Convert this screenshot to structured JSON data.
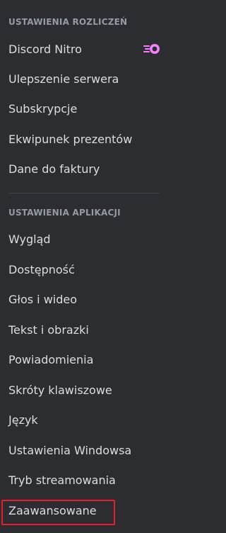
{
  "billing": {
    "header": "USTAWIENIA ROZLICZEŃ",
    "items": [
      {
        "label": "Discord Nitro",
        "icon": "nitro-icon"
      },
      {
        "label": "Ulepszenie serwera"
      },
      {
        "label": "Subskrypcje"
      },
      {
        "label": "Ekwipunek prezentów"
      },
      {
        "label": "Dane do faktury"
      }
    ]
  },
  "app": {
    "header": "USTAWIENIA APLIKACJI",
    "items": [
      {
        "label": "Wygląd"
      },
      {
        "label": "Dostępność"
      },
      {
        "label": "Głos i wideo"
      },
      {
        "label": "Tekst i obrazki"
      },
      {
        "label": "Powiadomienia"
      },
      {
        "label": "Skróty klawiszowe"
      },
      {
        "label": "Język"
      },
      {
        "label": "Ustawienia Windowsa"
      },
      {
        "label": "Tryb streamowania"
      },
      {
        "label": "Zaawansowane",
        "highlighted": true
      }
    ]
  },
  "colors": {
    "background": "#2b2d31",
    "header_text": "#949ba4",
    "item_text": "#dbdee1",
    "nitro_accent": "#f47fff",
    "highlight_border": "#ec1c2b"
  }
}
